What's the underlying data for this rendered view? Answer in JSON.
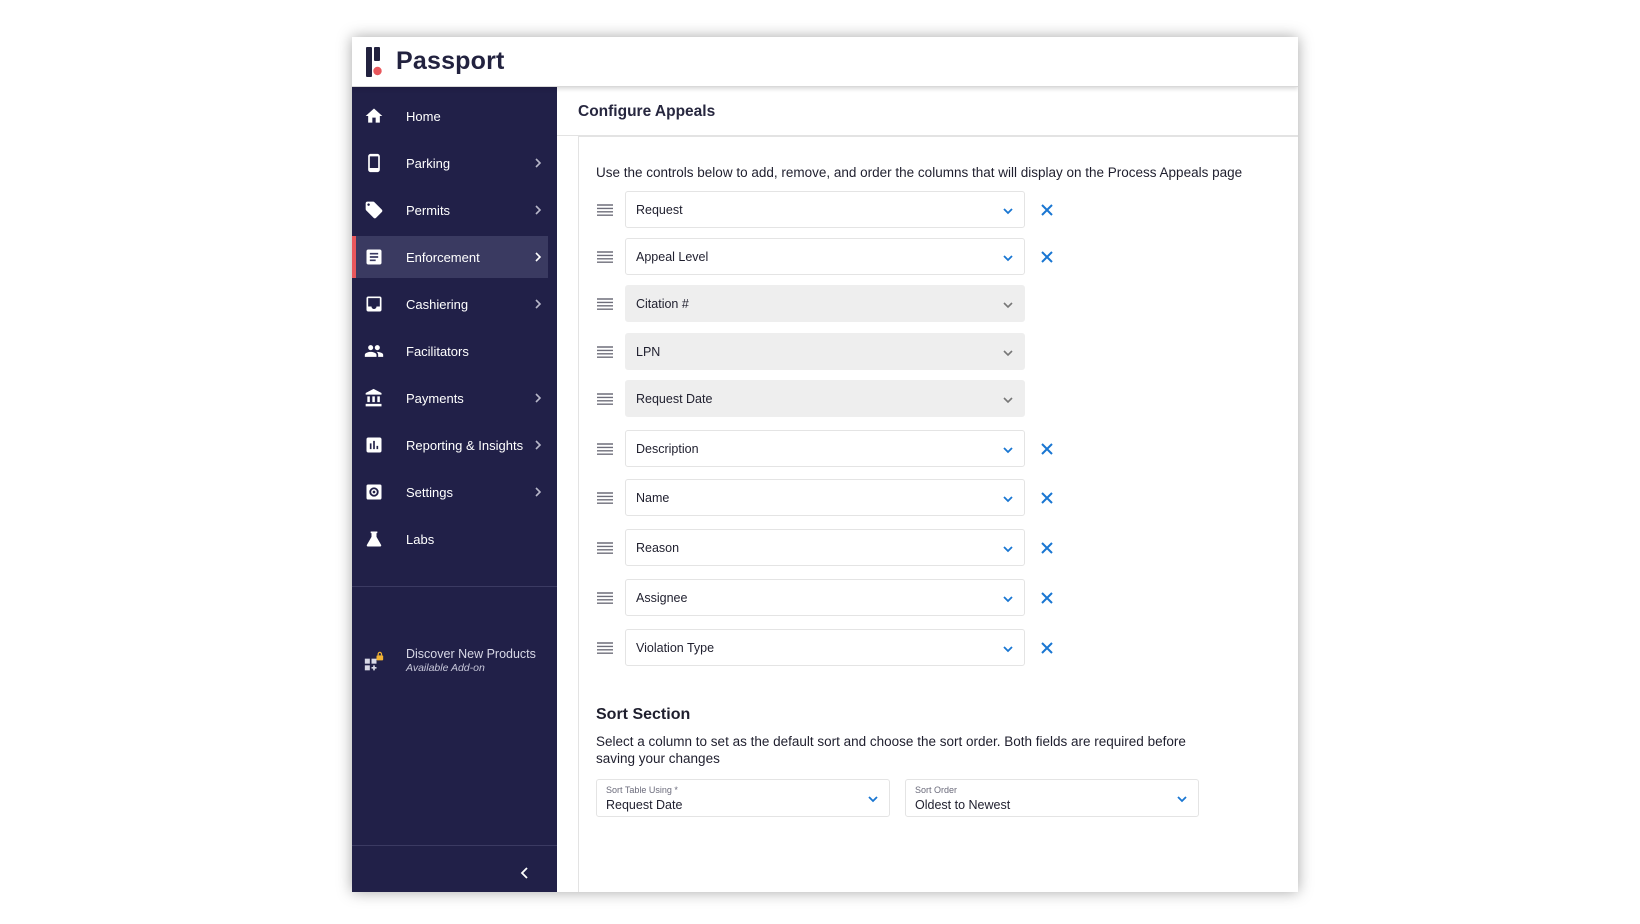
{
  "app": {
    "name": "Passport",
    "accent_color": "#e8575c",
    "sidebar_color": "#212048",
    "link_color": "#1976d2"
  },
  "sidebar": {
    "items": [
      {
        "label": "Home",
        "icon": "home-icon",
        "has_submenu": false,
        "active": false
      },
      {
        "label": "Parking",
        "icon": "smartphone-icon",
        "has_submenu": true,
        "active": false
      },
      {
        "label": "Permits",
        "icon": "tag-icon",
        "has_submenu": true,
        "active": false
      },
      {
        "label": "Enforcement",
        "icon": "list-document-icon",
        "has_submenu": true,
        "active": true
      },
      {
        "label": "Cashiering",
        "icon": "inbox-icon",
        "has_submenu": true,
        "active": false
      },
      {
        "label": "Facilitators",
        "icon": "people-icon",
        "has_submenu": false,
        "active": false
      },
      {
        "label": "Payments",
        "icon": "bank-icon",
        "has_submenu": true,
        "active": false
      },
      {
        "label": "Reporting & Insights",
        "icon": "bar-chart-icon",
        "has_submenu": true,
        "active": false
      },
      {
        "label": "Settings",
        "icon": "settings-icon",
        "has_submenu": true,
        "active": false
      },
      {
        "label": "Labs",
        "icon": "flask-icon",
        "has_submenu": false,
        "active": false
      }
    ],
    "discover": {
      "title": "Discover New Products",
      "subtitle": "Available Add-on",
      "icon": "locked-add-on-icon"
    }
  },
  "main": {
    "title": "Configure Appeals",
    "instructions": "Use the controls below to add, remove, and order the columns that will display on the Process Appeals page",
    "columns": [
      {
        "value": "Request",
        "locked": false
      },
      {
        "value": "Appeal Level",
        "locked": false
      },
      {
        "value": "Citation #",
        "locked": true
      },
      {
        "value": "LPN",
        "locked": true
      },
      {
        "value": "Request Date",
        "locked": true
      },
      {
        "value": "Description",
        "locked": false
      },
      {
        "value": "Name",
        "locked": false
      },
      {
        "value": "Reason",
        "locked": false
      },
      {
        "value": "Assignee",
        "locked": false
      },
      {
        "value": "Violation Type",
        "locked": false
      }
    ],
    "sort": {
      "heading": "Sort Section",
      "description": "Select a column to set as the default sort and choose the sort order. Both fields are required before saving your changes",
      "table_label": "Sort Table Using *",
      "table_value": "Request Date",
      "order_label": "Sort Order",
      "order_value": "Oldest to Newest"
    }
  }
}
